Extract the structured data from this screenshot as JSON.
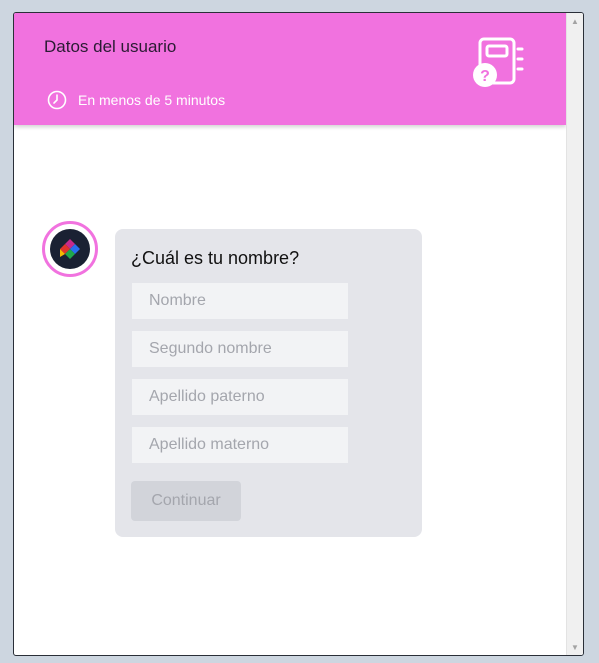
{
  "header": {
    "title": "Datos del usuario",
    "subtitle": "En menos de 5 minutos",
    "background": "#f172df"
  },
  "icons": {
    "clock": "clock-icon",
    "notebook": "notebook-question-icon",
    "avatar": "bot-logo-icon"
  },
  "form": {
    "question": "¿Cuál es tu nombre?",
    "fields": {
      "first_name_placeholder": "Nombre",
      "second_name_placeholder": "Segundo nombre",
      "paternal_placeholder": "Apellido paterno",
      "maternal_placeholder": "Apellido materno"
    },
    "continue_label": "Continuar"
  },
  "colors": {
    "accent": "#f172df",
    "card": "#e4e5ea",
    "button_disabled": "#d2d4da"
  }
}
